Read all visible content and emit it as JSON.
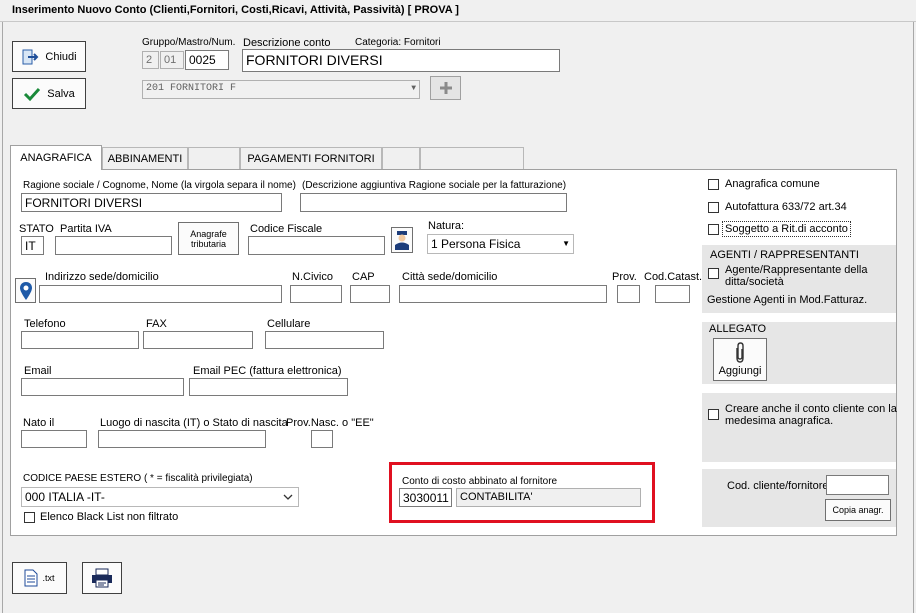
{
  "window": {
    "title": "Inserimento Nuovo Conto (Clienti,Fornitori, Costi,Ricavi, Attività, Passività)    [ PROVA ]"
  },
  "toolbar": {
    "close_label": "Chiudi",
    "save_label": "Salva"
  },
  "header": {
    "code_label": "Gruppo/Mastro/Num.",
    "desc_label": "Descrizione conto",
    "category_label": "Categoria: Fornitori",
    "gruppo": "2",
    "mastro": "01",
    "numero": "0025",
    "descrizione": "FORNITORI DIVERSI",
    "mastro_select": "201 FORNITORI F"
  },
  "tabs": [
    {
      "label": "ANAGRAFICA"
    },
    {
      "label": "ABBINAMENTI"
    },
    {
      "label": ""
    },
    {
      "label": "PAGAMENTI FORNITORI"
    },
    {
      "label": ""
    },
    {
      "label": ""
    }
  ],
  "form": {
    "ragione_label": "Ragione sociale / Cognome, Nome (la virgola separa il nome)",
    "ragione_value": "FORNITORI DIVERSI",
    "desc_agg_label": "(Descrizione aggiuntiva  Ragione sociale per la fatturazione)",
    "stato_label": "STATO",
    "stato_value": "IT",
    "piva_label": "Partita IVA",
    "anagrafe_label_1": "Anagrafe",
    "anagrafe_label_2": "tributaria",
    "cf_label": "Codice Fiscale",
    "natura_label": "Natura:",
    "natura_value": "1 Persona Fisica",
    "indirizzo_label": "Indirizzo sede/domicilio",
    "civico_label": "N.Civico",
    "cap_label": "CAP",
    "citta_label": "Città sede/domicilio",
    "prov_label": "Prov.",
    "catast_label": "Cod.Catast.",
    "telefono_label": "Telefono",
    "fax_label": "FAX",
    "cellulare_label": "Cellulare",
    "email_label": "Email",
    "pec_label": "Email PEC (fattura elettronica)",
    "nato_label": "Nato il",
    "luogo_label": "Luogo di nascita (IT) o Stato di nascita",
    "provnasc_label": "Prov.Nasc. o \"EE\"",
    "paese_label": "CODICE PAESE ESTERO ( * = fiscalità privilegiata)",
    "paese_value": "000 ITALIA  -IT-",
    "blacklist_label": "Elenco Black List non filtrato",
    "conto_costo_label": "Conto di costo abbinato al fornitore",
    "conto_costo_code": "3030011",
    "conto_costo_desc": "CONTABILITA'"
  },
  "side": {
    "anag_comune": "Anagrafica comune",
    "autofattura": "Autofattura 633/72 art.34",
    "ritenuta": "Soggetto a Rit.di acconto",
    "agenti_title": "AGENTI / RAPPRESENTANTI",
    "agente_chk_1": "Agente/Rappresentante della",
    "agente_chk_2": "ditta/società",
    "gestione_agenti": "Gestione Agenti in Mod.Fatturaz.",
    "allegato_title": "ALLEGATO",
    "aggiungi": "Aggiungi",
    "crea_cliente_1": "Creare anche il conto cliente con la",
    "crea_cliente_2": "medesima anagrafica.",
    "cod_cliente_label": "Cod. cliente/fornitore",
    "copia_anagr": "Copia anagr."
  },
  "bottom": {
    "txt_label": ".txt"
  }
}
